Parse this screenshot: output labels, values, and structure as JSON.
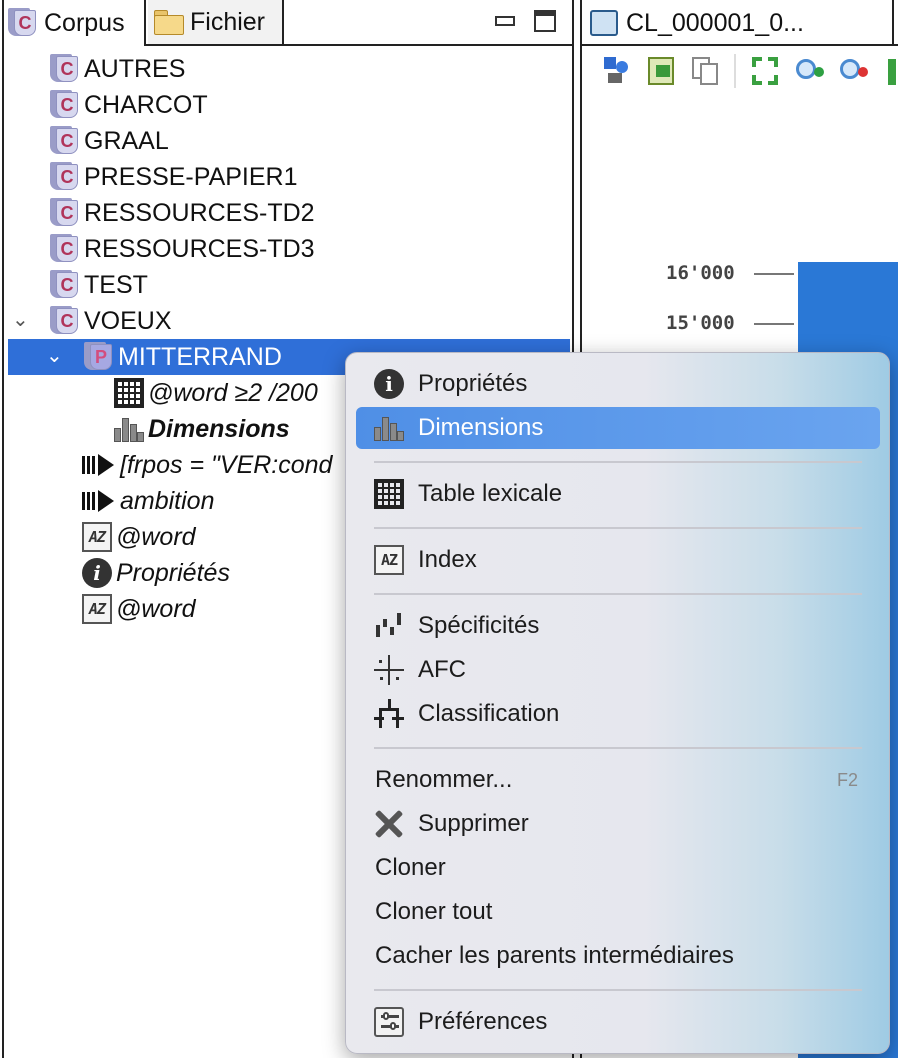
{
  "left_panel": {
    "tabs": [
      {
        "label": "Corpus",
        "icon": "corpus-icon"
      },
      {
        "label": "Fichier",
        "icon": "folder-icon"
      }
    ],
    "tree": [
      {
        "label": "AUTRES",
        "icon": "corpus-icon"
      },
      {
        "label": "CHARCOT",
        "icon": "corpus-icon"
      },
      {
        "label": "GRAAL",
        "icon": "corpus-icon"
      },
      {
        "label": "PRESSE-PAPIER1",
        "icon": "corpus-icon"
      },
      {
        "label": "RESSOURCES-TD2",
        "icon": "corpus-icon"
      },
      {
        "label": "RESSOURCES-TD3",
        "icon": "corpus-icon"
      },
      {
        "label": "TEST",
        "icon": "corpus-icon"
      },
      {
        "label": "VOEUX",
        "icon": "corpus-icon",
        "expanded": true
      },
      {
        "label": "MITTERRAND",
        "icon": "partition-icon",
        "expanded": true,
        "selected": true
      },
      {
        "label": "@word ≥2 /200",
        "icon": "lexical-table-icon"
      },
      {
        "label": "Dimensions",
        "icon": "dimensions-icon"
      },
      {
        "label": "[frpos = \"VER:cond",
        "icon": "concordance-icon"
      },
      {
        "label": "ambition",
        "icon": "concordance-icon"
      },
      {
        "label": "@word",
        "icon": "index-icon"
      },
      {
        "label": "Propriétés",
        "icon": "info-icon"
      },
      {
        "label": "@word",
        "icon": "index-icon"
      }
    ]
  },
  "right_panel": {
    "editor_tab": "CL_000001_0...",
    "toolbar_icons": [
      "shapes-icon",
      "export-icon",
      "copy-icon",
      "fit-icon",
      "zoom-in-icon",
      "zoom-out-icon",
      "chart-icon"
    ],
    "y_ticks": [
      "16'000",
      "15'000"
    ]
  },
  "context_menu": {
    "items": [
      {
        "label": "Propriétés",
        "icon": "info-icon"
      },
      {
        "label": "Dimensions",
        "icon": "dimensions-icon",
        "highlighted": true
      },
      {
        "label": "Table lexicale",
        "icon": "lexical-table-icon"
      },
      {
        "label": "Index",
        "icon": "index-icon"
      },
      {
        "label": "Spécificités",
        "icon": "specificities-icon"
      },
      {
        "label": "AFC",
        "icon": "afc-icon"
      },
      {
        "label": "Classification",
        "icon": "classification-icon"
      },
      {
        "label": "Renommer...",
        "shortcut": "F2"
      },
      {
        "label": "Supprimer",
        "icon": "delete-icon"
      },
      {
        "label": "Cloner"
      },
      {
        "label": "Cloner tout"
      },
      {
        "label": "Cacher les parents intermédiaires"
      },
      {
        "label": "Préférences",
        "icon": "preferences-icon"
      }
    ]
  },
  "colors": {
    "selection": "#2f6fd8",
    "menu_highlight": "#5b9ae9",
    "chart_bar": "#2a78d6"
  }
}
